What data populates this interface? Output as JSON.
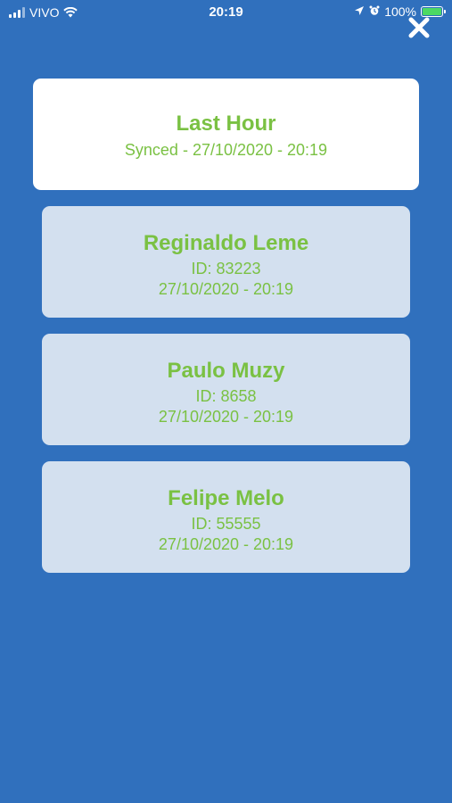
{
  "status_bar": {
    "carrier": "VIVO",
    "time": "20:19",
    "battery": "100%"
  },
  "header_card": {
    "title": "Last Hour",
    "subtitle": "Synced - 27/10/2020 - 20:19"
  },
  "users": [
    {
      "name": "Reginaldo Leme",
      "id": "ID: 83223",
      "date": "27/10/2020 - 20:19"
    },
    {
      "name": "Paulo Muzy",
      "id": "ID: 8658",
      "date": "27/10/2020 - 20:19"
    },
    {
      "name": "Felipe Melo",
      "id": "ID: 55555",
      "date": "27/10/2020 - 20:19"
    }
  ],
  "colors": {
    "background": "#3070bd",
    "accent_text": "#7ac143",
    "card_header": "#ffffff",
    "card_user": "#d3e0ef"
  },
  "icons": {
    "close": "close-icon",
    "signal": "signal-icon",
    "wifi": "wifi-icon",
    "location": "location-arrow-icon",
    "alarm": "alarm-icon",
    "battery": "battery-icon"
  }
}
